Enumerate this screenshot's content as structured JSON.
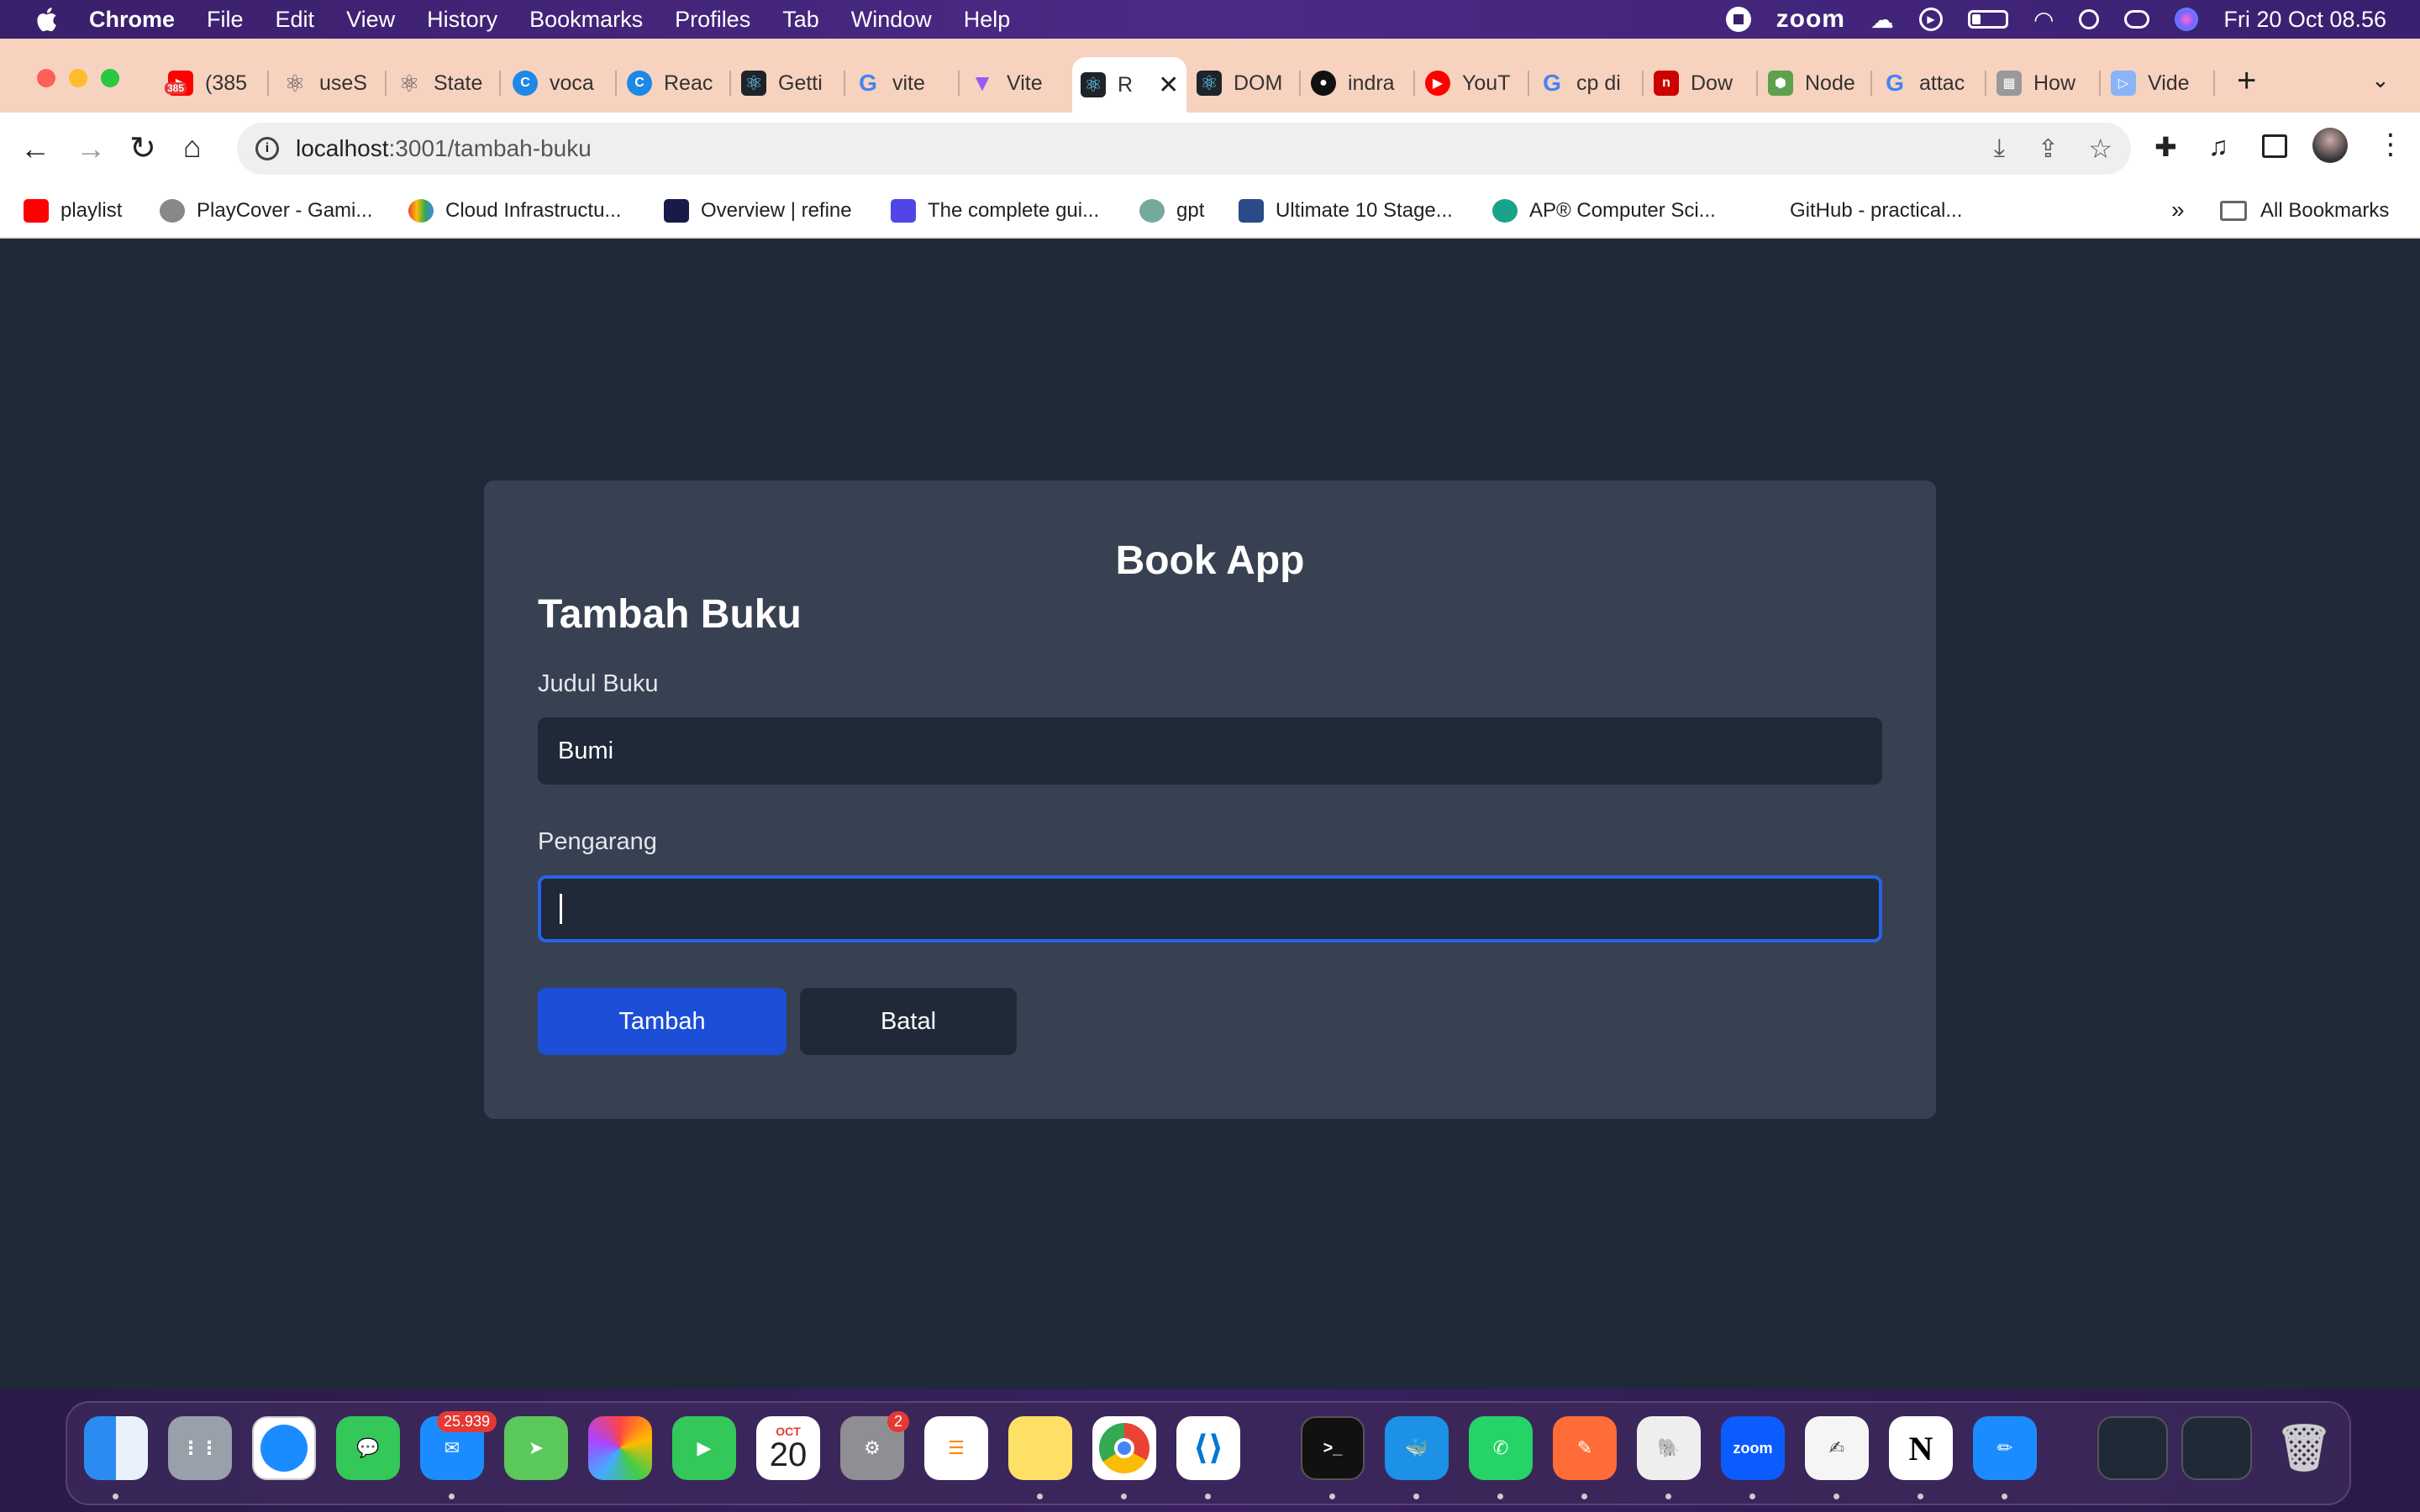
{
  "menubar": {
    "app": "Chrome",
    "items": [
      "File",
      "Edit",
      "View",
      "History",
      "Bookmarks",
      "Profiles",
      "Tab",
      "Window",
      "Help"
    ],
    "zoom_label": "zoom",
    "datetime": "Fri 20 Oct  08.56"
  },
  "tabs": [
    {
      "label": "(385",
      "icon": "youtube-icon"
    },
    {
      "label": "useS",
      "icon": "react-icon"
    },
    {
      "label": "State",
      "icon": "react-icon"
    },
    {
      "label": "voca",
      "icon": "circle-c-icon"
    },
    {
      "label": "Reac",
      "icon": "circle-c-icon"
    },
    {
      "label": "Getti",
      "icon": "react-icon"
    },
    {
      "label": "vite",
      "icon": "google-icon"
    },
    {
      "label": "Vite",
      "icon": "vite-icon"
    },
    {
      "label": "R",
      "icon": "react-icon"
    },
    {
      "label": "DOM",
      "icon": "react-icon"
    },
    {
      "label": "indra",
      "icon": "github-icon"
    },
    {
      "label": "YouT",
      "icon": "youtube-icon"
    },
    {
      "label": "cp di",
      "icon": "google-icon"
    },
    {
      "label": "Dow",
      "icon": "n-icon"
    },
    {
      "label": "Node",
      "icon": "node-icon"
    },
    {
      "label": "attac",
      "icon": "google-icon"
    },
    {
      "label": "How",
      "icon": "page-icon"
    },
    {
      "label": "Vide",
      "icon": "video-icon"
    }
  ],
  "tab_badge": "385",
  "address": {
    "host": "localhost",
    "path": ":3001/tambah-buku"
  },
  "bookmarks": [
    {
      "label": "playlist",
      "color": "#ff0000"
    },
    {
      "label": "PlayCover - Gami...",
      "color": "#888888"
    },
    {
      "label": "Cloud Infrastructu...",
      "color": "#f4b400"
    },
    {
      "label": "Overview | refine",
      "color": "#1a1a4a"
    },
    {
      "label": "The complete gui...",
      "color": "#4f46e5"
    },
    {
      "label": "gpt",
      "color": "#74aa9c"
    },
    {
      "label": "Ultimate 10 Stage...",
      "color": "#2b4a8a"
    },
    {
      "label": "AP® Computer Sci...",
      "color": "#1aa38a"
    },
    {
      "label": "GitHub - practical...",
      "color": "#ffffff"
    }
  ],
  "bookmarks_more": "»",
  "all_bookmarks": "All Bookmarks",
  "app": {
    "title": "Book App",
    "form_title": "Tambah Buku",
    "title_label": "Judul Buku",
    "title_value": "Bumi",
    "author_label": "Pengarang",
    "author_value": "",
    "submit": "Tambah",
    "cancel": "Batal"
  },
  "dock": {
    "mail_badge": "25.939",
    "calendar_month": "OCT",
    "calendar_day": "20",
    "settings_badge": "2",
    "zoom_label": "zoom"
  }
}
